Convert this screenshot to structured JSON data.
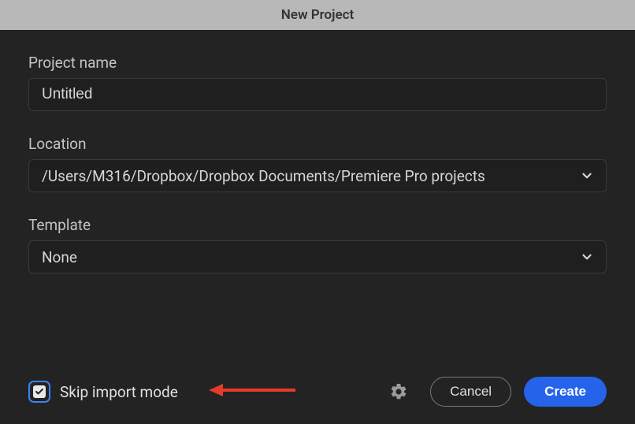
{
  "dialog": {
    "title": "New Project"
  },
  "fields": {
    "project_name": {
      "label": "Project name",
      "value": "Untitled"
    },
    "location": {
      "label": "Location",
      "value": "/Users/M316/Dropbox/Dropbox Documents/Premiere Pro projects"
    },
    "template": {
      "label": "Template",
      "value": "None"
    }
  },
  "footer": {
    "skip_label": "Skip import mode",
    "skip_checked": true,
    "cancel_label": "Cancel",
    "create_label": "Create"
  }
}
